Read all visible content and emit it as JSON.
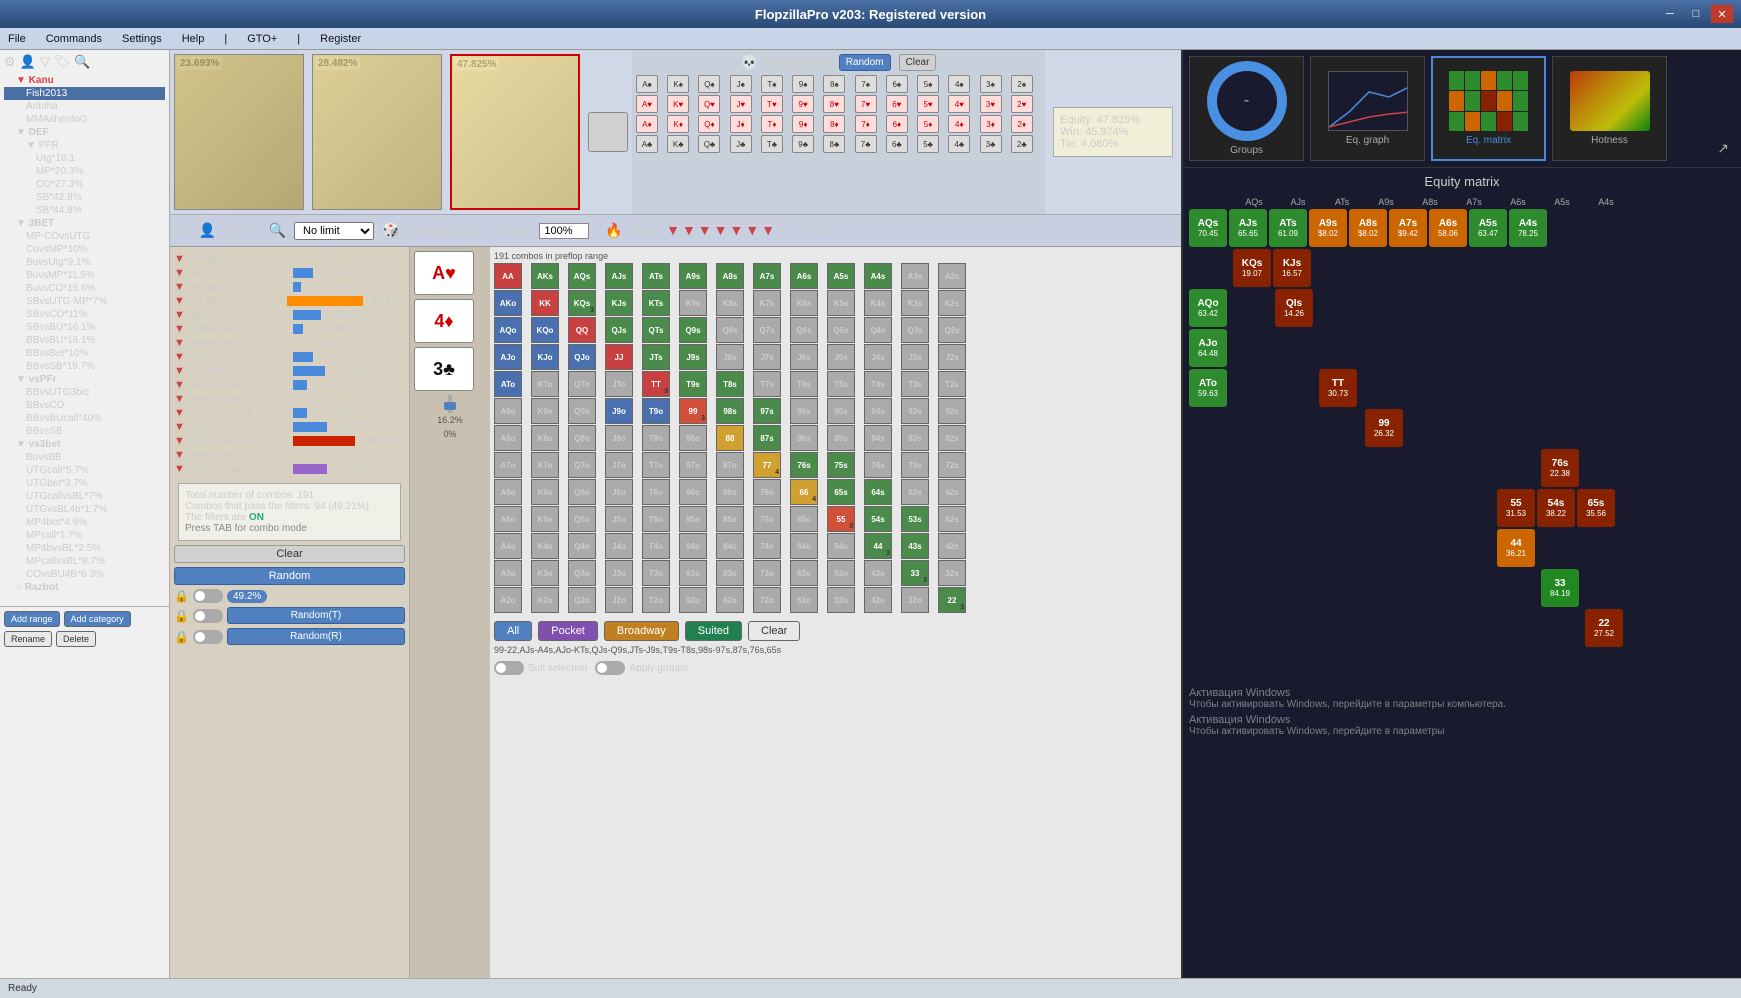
{
  "app": {
    "title": "FlopzillaPro v203: Registered version",
    "status": "Ready"
  },
  "menu": {
    "items": [
      "File",
      "Commands",
      "Settings",
      "Help",
      "|",
      "GTO+",
      "|",
      "Register"
    ]
  },
  "ranges": [
    {
      "id": 1,
      "pct": "23.693%",
      "active": false
    },
    {
      "id": 2,
      "pct": "28.482%",
      "active": false
    },
    {
      "id": 3,
      "pct": "47.825%",
      "active": true
    }
  ],
  "equity": {
    "label": "Equity:",
    "equity_val": "47.825%",
    "win_label": "Win:",
    "win_val": "45.974%",
    "tie_label": "Tie:",
    "tie_val": "4.080%"
  },
  "dead_cards": {
    "label": "Dead cards",
    "random_label": "Random",
    "clear_label": "Clear"
  },
  "toolbar": {
    "limit": "No limit",
    "starting_hand": "Starting hand",
    "weight": "Weight:",
    "weight_val": "100%",
    "flop": "Flop"
  },
  "flop_cards": [
    {
      "rank": "A",
      "suit": "♥",
      "suit_type": "heart"
    },
    {
      "rank": "4",
      "suit": "♦",
      "suit_type": "diamond"
    },
    {
      "rank": "3",
      "suit": "♣",
      "suit_type": "club"
    }
  ],
  "filters": [
    {
      "name": "straight",
      "pct": "0%",
      "bar": 0,
      "highlight": false
    },
    {
      "name": "set",
      "pct": "6.38%",
      "bar": 12,
      "highlight": false
    },
    {
      "name": "two pair",
      "pct": "2.13%",
      "bar": 4,
      "highlight": false
    },
    {
      "name": "top pair",
      "pct": "47.67%",
      "bar": 90,
      "highlight": true
    },
    {
      "name": "pp < top card",
      "pct": "15.96%",
      "bar": 30,
      "highlight": false
    },
    {
      "name": "middle pair",
      "pct": "3.19%",
      "bar": 6,
      "highlight": false
    },
    {
      "name": "bottom pair",
      "pct": "0%",
      "bar": 0,
      "highlight": false
    },
    {
      "name": "pp < board",
      "pct": "6.38%",
      "bar": 12,
      "highlight": false
    },
    {
      "name": "no made hand",
      "pct": "18.09%",
      "bar": 34,
      "highlight": false
    },
    {
      "name": "oesd (2 card)",
      "pct": "4.26%",
      "bar": 8,
      "highlight": false
    },
    {
      "name": "oesd (1 card)",
      "pct": "0%",
      "bar": 0,
      "highlight": false
    },
    {
      "name": "gutshot (2 crd)",
      "pct": "4.26%",
      "bar": 8,
      "highlight": false
    },
    {
      "name": "gutshot (1 crd)",
      "pct": "19.15%",
      "bar": 36,
      "highlight": false
    },
    {
      "name": "2 crd bckdr fd",
      "pct": "35.11%",
      "bar": 66,
      "highlight": false
    },
    {
      "name": "oesd+pair",
      "pct": "0%",
      "bar": 0,
      "highlight": false
    },
    {
      "name": "gutshot+pair",
      "pct": "19.15%",
      "bar": 36,
      "highlight": false
    }
  ],
  "combo_info": {
    "total": "Total number of combos: 191",
    "pass": "Combos that pass the filters: 94 (49.21%)",
    "filters_on": "The filters are ON",
    "tab_hint": "Press TAB for combo mode"
  },
  "bottom_buttons": {
    "clear": "Clear",
    "random": "Random",
    "random_t": "Random(T)",
    "random_r": "Random(R)"
  },
  "action_buttons": {
    "all": "All",
    "pocket": "Pocket",
    "broadway": "Broadway",
    "suited": "Suited",
    "clear": "Clear"
  },
  "range_text": "99-22,AJs-A4s,AJo-KTs,QJs-Q9s,JTs-J9s,T9s-T8s,98s-97s,87s,76s,65s",
  "suit_selection": {
    "label": "Suit selection"
  },
  "apply_groups": {
    "label": "Apply groups"
  },
  "slider_pct": "16.2%",
  "progress_pct": "0%",
  "preflop_combos": "191 combos in preflop range",
  "pct_badge": "49.2%",
  "left_panel": {
    "nodes": [
      {
        "label": "Kanu",
        "level": 1,
        "expanded": true
      },
      {
        "label": "Fish2013",
        "level": 2,
        "color": "blue",
        "pct": ""
      },
      {
        "label": "Antoha",
        "level": 2
      },
      {
        "label": "MMAsherdoG",
        "level": 2
      },
      {
        "label": "DEF",
        "level": 1,
        "expanded": true
      },
      {
        "label": "PFR",
        "level": 2,
        "expanded": true
      },
      {
        "label": "Utg*16.1",
        "level": 3
      },
      {
        "label": "MP*20.3%",
        "level": 3
      },
      {
        "label": "CO*27.3%",
        "level": 3
      },
      {
        "label": "SB*42.8%",
        "level": 3
      },
      {
        "label": "SB*44.8%",
        "level": 3
      },
      {
        "label": "3BET",
        "level": 1,
        "expanded": true
      },
      {
        "label": "MP-COvsUTG",
        "level": 2
      },
      {
        "label": "CovsMP*10%",
        "level": 2
      },
      {
        "label": "BuvsUtg*9.1%",
        "level": 2
      },
      {
        "label": "BuvsMP*11.5%",
        "level": 2
      },
      {
        "label": "BuvsCO*15.6%",
        "level": 2
      },
      {
        "label": "SBvsUTG-MP*7%",
        "level": 2
      },
      {
        "label": "SBvsCO*11%",
        "level": 2
      },
      {
        "label": "SBvsBU*16.1%",
        "level": 2
      },
      {
        "label": "BBvsBU*16.1%",
        "level": 2
      },
      {
        "label": "BBvsBet*10%",
        "level": 2
      },
      {
        "label": "BBvsSB*19.7%",
        "level": 2
      },
      {
        "label": "vsPFr",
        "level": 1,
        "expanded": true
      },
      {
        "label": "BBvsUTG3b/c",
        "level": 2
      },
      {
        "label": "BBvsCO",
        "level": 2
      },
      {
        "label": "BBvsBUcall*40%",
        "level": 2
      },
      {
        "label": "BBvsSB",
        "level": 2
      },
      {
        "label": "vs3bet",
        "level": 1,
        "expanded": true
      },
      {
        "label": "BuvsBB",
        "level": 2
      },
      {
        "label": "UTGcall*5.7%",
        "level": 2
      },
      {
        "label": "UTGbet*3.7%",
        "level": 2
      },
      {
        "label": "UTGcallvsBL*7%",
        "level": 2
      },
      {
        "label": "UTGvsBL4b*1.7%",
        "level": 2
      },
      {
        "label": "MP4bet*4.6%",
        "level": 2
      },
      {
        "label": "MPcall*1.7%",
        "level": 2
      },
      {
        "label": "MP4bvsBL*2.5%",
        "level": 2
      },
      {
        "label": "MPcallvsBL*8.7%",
        "level": 2
      },
      {
        "label": "COvsBU4B*6.3%",
        "level": 2
      },
      {
        "label": "Razbot",
        "level": 1
      }
    ]
  },
  "equity_matrix": {
    "title": "Equity matrix",
    "cells": [
      {
        "name": "AQs",
        "val": "70.45",
        "color": "green",
        "col": 1,
        "row": 0
      },
      {
        "name": "AJs",
        "val": "65.65",
        "color": "green",
        "col": 2,
        "row": 0
      },
      {
        "name": "ATs",
        "val": "61.09",
        "color": "green",
        "col": 3,
        "row": 0
      },
      {
        "name": "A9s",
        "val": "$8.02",
        "color": "orange",
        "col": 4,
        "row": 0
      },
      {
        "name": "A8s",
        "val": "$8.02",
        "color": "orange",
        "col": 5,
        "row": 0
      },
      {
        "name": "A7s",
        "val": "$9.42",
        "color": "orange",
        "col": 6,
        "row": 0
      },
      {
        "name": "A6s",
        "val": "58.06",
        "color": "orange",
        "col": 7,
        "row": 0
      },
      {
        "name": "A5s",
        "val": "63.47",
        "color": "green",
        "col": 8,
        "row": 0
      },
      {
        "name": "A4s",
        "val": "78.25",
        "color": "green",
        "col": 9,
        "row": 0
      },
      {
        "name": "KQs",
        "val": "19.07",
        "color": "red",
        "col": 1,
        "row": 1
      },
      {
        "name": "KJs",
        "val": "16.57",
        "color": "red",
        "col": 2,
        "row": 1
      },
      {
        "name": "AQo",
        "val": "63.42",
        "color": "green",
        "col": 0,
        "row": 2
      },
      {
        "name": "QIs",
        "val": "14.26",
        "color": "red",
        "col": 2,
        "row": 2
      },
      {
        "name": "AJo",
        "val": "64.48",
        "color": "green",
        "col": 0,
        "row": 3
      },
      {
        "name": "ATo",
        "val": "59.63",
        "color": "green",
        "col": 0,
        "row": 4
      },
      {
        "name": "TT",
        "val": "30.73",
        "color": "red",
        "col": 3,
        "row": 4
      },
      {
        "name": "99",
        "val": "26.32",
        "color": "red",
        "col": 4,
        "row": 5
      },
      {
        "name": "76s",
        "val": "22.38",
        "color": "red",
        "col": 8,
        "row": 6
      },
      {
        "name": "65s",
        "val": "35.56",
        "color": "red",
        "col": 9,
        "row": 7
      },
      {
        "name": "55",
        "val": "31.53",
        "color": "red",
        "col": 8,
        "row": 7
      },
      {
        "name": "54s",
        "val": "38.22",
        "color": "red",
        "col": 9,
        "row": 7
      },
      {
        "name": "44",
        "val": "36.21",
        "color": "orange",
        "col": 8,
        "row": 8
      },
      {
        "name": "33",
        "val": "84.19",
        "color": "green",
        "col": 9,
        "row": 9
      },
      {
        "name": "22",
        "val": "27.52",
        "color": "red",
        "col": 10,
        "row": 10
      }
    ]
  },
  "thumbnails": [
    {
      "id": "groups",
      "label": "Groups"
    },
    {
      "id": "eq_graph",
      "label": "Eq. graph"
    },
    {
      "id": "eq_matrix",
      "label": "Eq. matrix",
      "active": true
    },
    {
      "id": "hotness",
      "label": "Hotness"
    }
  ],
  "range_matrix_cells": [
    [
      "AA",
      "AKs",
      "AQs",
      "AJs",
      "ATs",
      "A9s",
      "A8s",
      "A7s",
      "A6s",
      "A5s",
      "A4s",
      "A3s",
      "A2s"
    ],
    [
      "AKo",
      "KK",
      "KQs",
      "KJs",
      "KTs",
      "K9s",
      "K8s",
      "K7s",
      "K6s",
      "K5s",
      "K4s",
      "K3s",
      "K2s"
    ],
    [
      "AQo",
      "KQo",
      "QQ",
      "QJs",
      "QTs",
      "Q9s",
      "Q8s",
      "Q7s",
      "Q6s",
      "Q5s",
      "Q4s",
      "Q3s",
      "Q2s"
    ],
    [
      "AJo",
      "KJo",
      "QJo",
      "JJ",
      "JTs",
      "J9s",
      "J8s",
      "J7s",
      "J6s",
      "J5s",
      "J4s",
      "J3s",
      "J2s"
    ],
    [
      "ATo",
      "KTo",
      "QTo",
      "JTo",
      "TT",
      "T9s",
      "T8s",
      "T7s",
      "T6s",
      "T5s",
      "T4s",
      "T3s",
      "T2s"
    ],
    [
      "A9o",
      "K9o",
      "Q9o",
      "J9o",
      "T9o",
      "99",
      "98s",
      "97s",
      "96s",
      "95s",
      "94s",
      "93s",
      "92s"
    ],
    [
      "A8o",
      "K8o",
      "Q8o",
      "J8o",
      "T8o",
      "98o",
      "88",
      "87s",
      "86s",
      "85s",
      "84s",
      "83s",
      "82s"
    ],
    [
      "A7o",
      "K7o",
      "Q7o",
      "J7o",
      "T7o",
      "97o",
      "87o",
      "77",
      "76s",
      "75s",
      "74s",
      "73s",
      "72s"
    ],
    [
      "A6o",
      "K6o",
      "Q6o",
      "J6o",
      "T6o",
      "96o",
      "86o",
      "76o",
      "66",
      "65s",
      "64s",
      "63s",
      "62s"
    ],
    [
      "A5o",
      "K5o",
      "Q5o",
      "J5o",
      "T5o",
      "95o",
      "85o",
      "75o",
      "65o",
      "55",
      "54s",
      "53s",
      "52s"
    ],
    [
      "A4o",
      "K4o",
      "Q4o",
      "J4o",
      "T4o",
      "94o",
      "84o",
      "74o",
      "64o",
      "54o",
      "44",
      "43s",
      "42s"
    ],
    [
      "A3o",
      "K3o",
      "Q3o",
      "J3o",
      "T3o",
      "93o",
      "83o",
      "73o",
      "63o",
      "53o",
      "43o",
      "33",
      "32s"
    ],
    [
      "A2o",
      "K2o",
      "Q2o",
      "J2o",
      "T2o",
      "92o",
      "82o",
      "72o",
      "62o",
      "52o",
      "42o",
      "32o",
      "22"
    ]
  ]
}
